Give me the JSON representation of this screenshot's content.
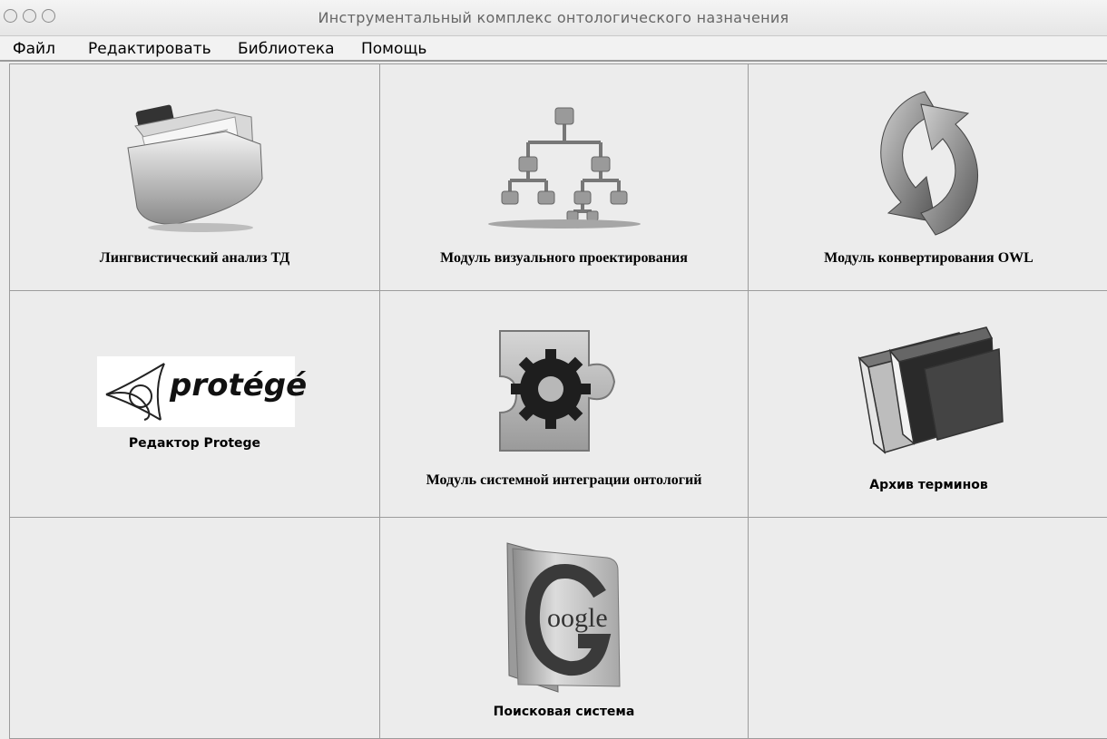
{
  "window": {
    "title": "Инструментальный комплекс онтологического назначения"
  },
  "menu": {
    "items": [
      "Файл",
      "Редактировать",
      "Библиотека",
      "Помощь"
    ]
  },
  "modules": [
    {
      "label": "Лингвистический анализ ТД",
      "icon": "document-folder-icon"
    },
    {
      "label": "Модуль визуального проектирования",
      "icon": "hierarchy-diagram-icon"
    },
    {
      "label": "Модуль конвертирования OWL",
      "icon": "sync-arrows-icon"
    },
    {
      "label": "Редактор Protege",
      "icon": "protege-logo",
      "logo_text": "protégé"
    },
    {
      "label": "Модуль системной интеграции онтологий",
      "icon": "puzzle-gear-icon"
    },
    {
      "label": "Архив терминов",
      "icon": "books-icon"
    },
    {
      "label": "",
      "icon": ""
    },
    {
      "label": "Поисковая система",
      "icon": "google-folder-icon",
      "logo_text": "oogle"
    },
    {
      "label": "",
      "icon": ""
    }
  ]
}
